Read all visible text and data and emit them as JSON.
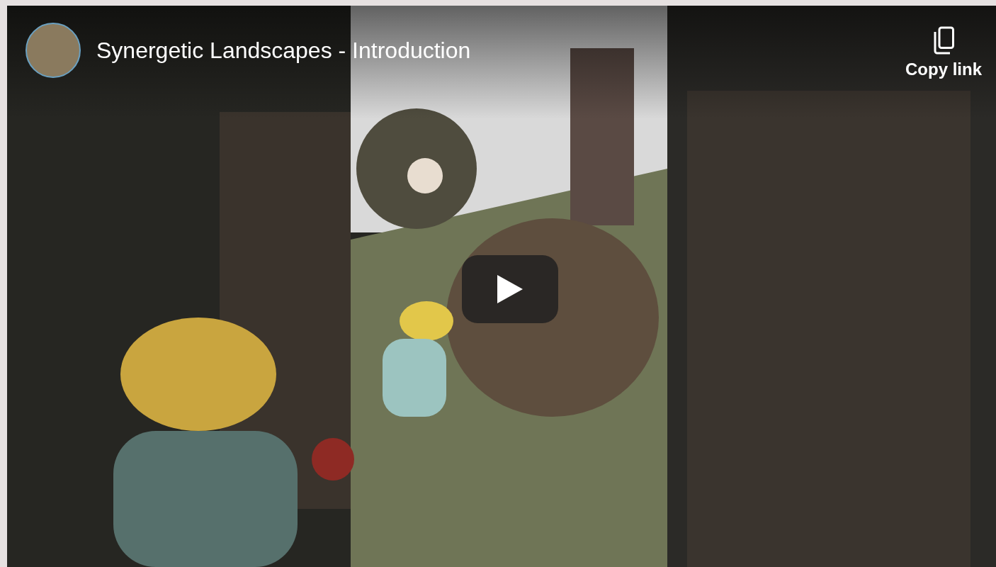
{
  "player": {
    "title": "Synergetic Landscapes - Introduction",
    "share": {
      "label": "Copy link"
    }
  }
}
